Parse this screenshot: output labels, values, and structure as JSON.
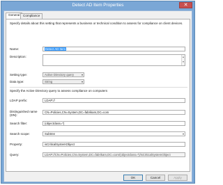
{
  "window": {
    "title": "Detect AD Item Properties",
    "close_glyph": "✕"
  },
  "tabs": [
    {
      "label": "General",
      "active": true
    },
    {
      "label": "Compliance Rules",
      "active": false
    }
  ],
  "general": {
    "description_text": "Specify details about this setting that represents a business or technical condition to assess for compliance on client devices.",
    "name_label": "Name:",
    "name_value": "Detect AD Item",
    "description_label": "Description:",
    "description_value": "",
    "setting_type_label": "Setting type:",
    "setting_type_value": "Active Directory query",
    "data_type_label": "Data type:",
    "data_type_value": "String"
  },
  "query": {
    "section_text": "Specify the Active Directory query to assess compliance on computers",
    "ldap_prefix_label": "LDAP prefix:",
    "ldap_prefix_value": "LDAP://",
    "dn_label": "Distinguished name (DN):",
    "dn_value": "CN=Policies,CN=System,DC=fabrikam,DC=com",
    "search_filter_label": "Search filter:",
    "search_filter_value": "(objectclass=*)",
    "search_scope_label": "Search scope:",
    "search_scope_value": "Subtree",
    "property_label": "Property:",
    "property_value": "isCriticalSystemObject",
    "query_label": "Query:",
    "query_value": "LDAP://CN=Policies,CN=System,DC=fabrikam,DC=com/(objectclass=*)/isCriticalSystemObject"
  },
  "buttons": {
    "ok": "OK",
    "cancel": "Cancel",
    "apply": "Apply"
  }
}
